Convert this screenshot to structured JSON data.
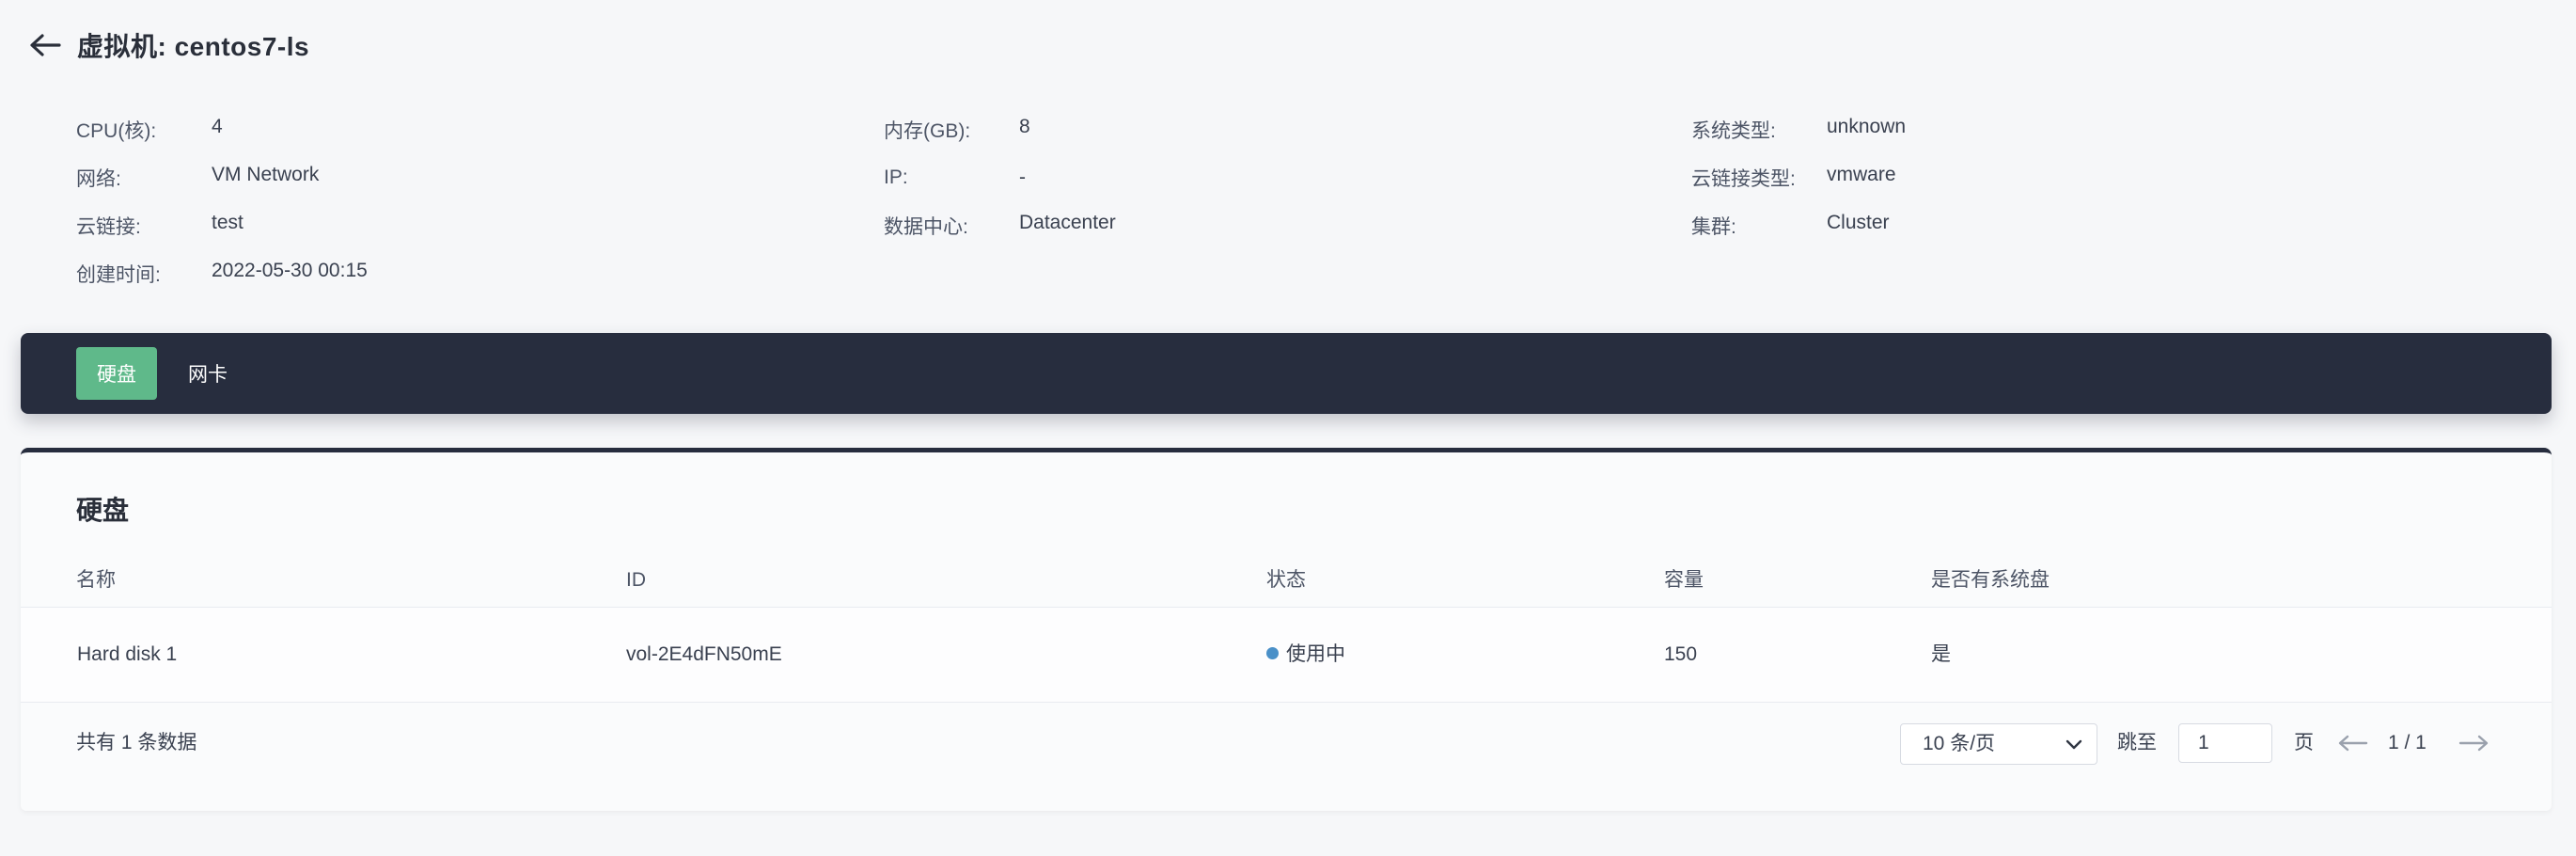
{
  "header": {
    "back_icon": "arrow-left-icon",
    "title": "虚拟机:  centos7-ls"
  },
  "info": {
    "rows": [
      [
        {
          "label": "CPU(核):",
          "value": "4"
        },
        {
          "label": "内存(GB):",
          "value": "8"
        },
        {
          "label": "系统类型:",
          "value": "unknown"
        }
      ],
      [
        {
          "label": "网络:",
          "value": "VM Network"
        },
        {
          "label": "IP:",
          "value": "-"
        },
        {
          "label": "云链接类型:",
          "value": "vmware"
        }
      ],
      [
        {
          "label": "云链接:",
          "value": "test"
        },
        {
          "label": "数据中心:",
          "value": "Datacenter"
        },
        {
          "label": "集群:",
          "value": "Cluster"
        }
      ],
      [
        {
          "label": "创建时间:",
          "value": "2022-05-30 00:15"
        }
      ]
    ]
  },
  "tabs": [
    {
      "label": "硬盘",
      "active": true
    },
    {
      "label": "网卡",
      "active": false
    }
  ],
  "panel": {
    "title": "硬盘",
    "columns": [
      "名称",
      "ID",
      "状态",
      "容量",
      "是否有系统盘"
    ],
    "rows": [
      {
        "name": "Hard disk 1",
        "id": "vol-2E4dFN50mE",
        "status": "使用中",
        "capacity": "150",
        "system_disk": "是"
      }
    ],
    "status_color": "#4a90c8"
  },
  "pagination": {
    "total": "共有 1 条数据",
    "page_size": "10 条/页",
    "jump_label": "跳至",
    "jump_value": "1",
    "page_label": "页",
    "page_count": "1 / 1"
  },
  "colors": {
    "accent": "#5fb98a",
    "tabbar": "#272d3e",
    "background": "#f6f7f9"
  }
}
